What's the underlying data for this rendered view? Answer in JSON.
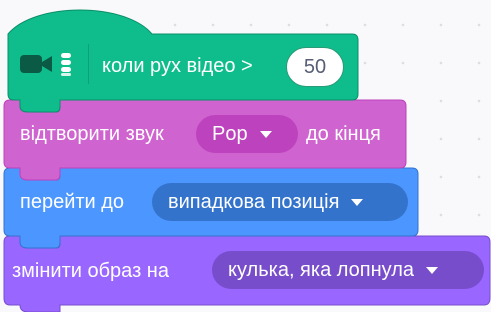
{
  "script": {
    "hat_block": {
      "category": "video sensing",
      "icon": "video-camera-icon",
      "label": "коли рух відео >",
      "operator_value": "50",
      "color": "#0fbd8c"
    },
    "block_2": {
      "category": "sound",
      "label_before": "відтворити звук",
      "dropdown_value": "Pop",
      "label_after": "до кінця",
      "color": "#cf63cf"
    },
    "block_3": {
      "category": "motion",
      "label": "перейти до",
      "dropdown_value": "випадкова позиція",
      "color": "#4c97ff"
    },
    "block_4": {
      "category": "looks",
      "label": "змінити образ на",
      "dropdown_value": "кулька, яка лопнула",
      "color": "#9966ff"
    }
  }
}
